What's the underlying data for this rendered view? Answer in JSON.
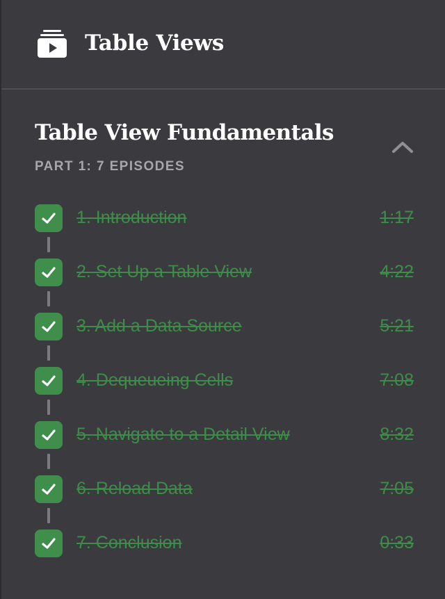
{
  "header": {
    "title": "Table Views",
    "icon": "video-course-icon"
  },
  "section": {
    "title": "Table View Fundamentals",
    "subtitle": "PART 1: 7 EPISODES",
    "collapse_icon": "chevron-up-icon"
  },
  "colors": {
    "background": "#3b3b3f",
    "completed": "#3e8c49",
    "subtitle": "#a6a7ad",
    "connector": "#7a7b80"
  },
  "episodes": [
    {
      "title": "1. Introduction",
      "duration": "1:17",
      "completed": true
    },
    {
      "title": "2. Set Up a Table View",
      "duration": "4:22",
      "completed": true
    },
    {
      "title": "3. Add a Data Source",
      "duration": "5:21",
      "completed": true
    },
    {
      "title": "4. Dequeueing Cells",
      "duration": "7:08",
      "completed": true
    },
    {
      "title": "5. Navigate to a Detail View",
      "duration": "8:32",
      "completed": true
    },
    {
      "title": "6. Reload Data",
      "duration": "7:05",
      "completed": true
    },
    {
      "title": "7. Conclusion",
      "duration": "0:33",
      "completed": true
    }
  ]
}
